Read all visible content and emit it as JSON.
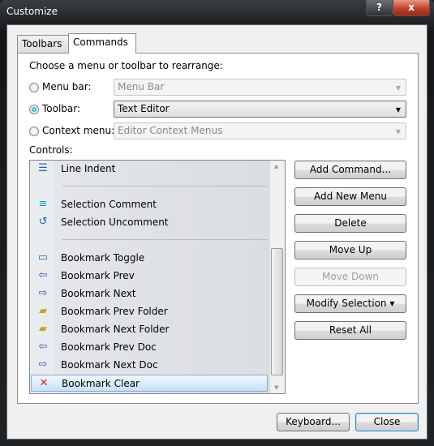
{
  "window": {
    "title": "Customize",
    "help": "?",
    "close": "x"
  },
  "tabs": [
    {
      "label": "Toolbars"
    },
    {
      "label": "Commands"
    }
  ],
  "prompt": "Choose a menu or toolbar to rearrange:",
  "options": [
    {
      "label": "Menu bar:",
      "value": "Menu Bar",
      "selected": false,
      "enabled": false
    },
    {
      "label": "Toolbar:",
      "value": "Text Editor",
      "selected": true,
      "enabled": true
    },
    {
      "label": "Context menu:",
      "value": "Editor Context Menus",
      "selected": false,
      "enabled": false
    }
  ],
  "controls_label": "Controls:",
  "controls": [
    {
      "label": "Line Indent",
      "icon": "indent-icon"
    },
    {
      "label": "Selection Comment",
      "icon": "comment-icon"
    },
    {
      "label": "Selection Uncomment",
      "icon": "uncomment-icon"
    },
    {
      "label": "Bookmark Toggle",
      "icon": "bookmark-icon"
    },
    {
      "label": "Bookmark Prev",
      "icon": "bookmark-prev-icon"
    },
    {
      "label": "Bookmark Next",
      "icon": "bookmark-next-icon"
    },
    {
      "label": "Bookmark Prev Folder",
      "icon": "folder-prev-icon"
    },
    {
      "label": "Bookmark Next Folder",
      "icon": "folder-next-icon"
    },
    {
      "label": "Bookmark Prev Doc",
      "icon": "doc-prev-icon"
    },
    {
      "label": "Bookmark Next Doc",
      "icon": "doc-next-icon"
    },
    {
      "label": "Bookmark Clear",
      "icon": "bookmark-clear-icon",
      "selected": true
    }
  ],
  "buttons": {
    "add_command": "Add Command...",
    "add_menu": "Add New Menu",
    "delete": "Delete",
    "move_up": "Move Up",
    "move_down": "Move Down",
    "modify": "Modify Selection ▾",
    "reset": "Reset All",
    "keyboard": "Keyboard...",
    "close": "Close"
  }
}
